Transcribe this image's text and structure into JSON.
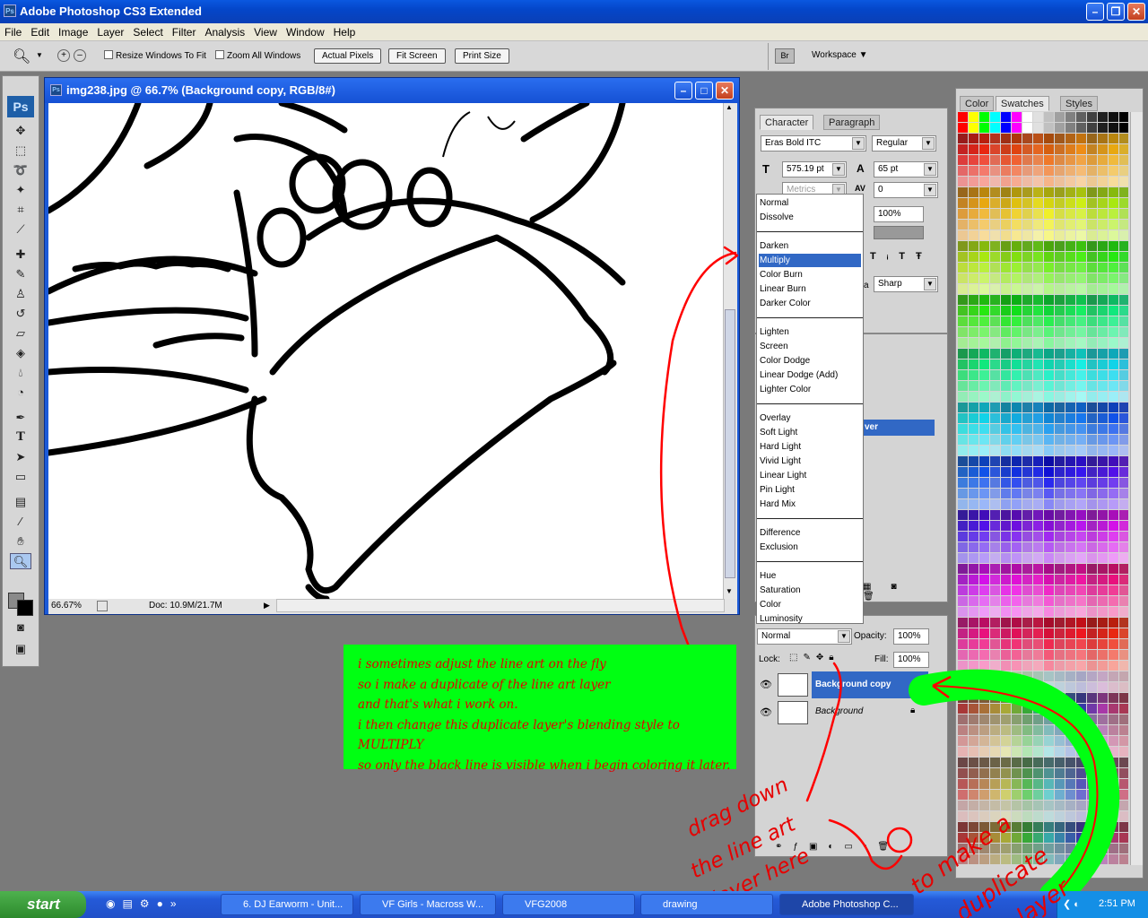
{
  "app": {
    "title": "Adobe Photoshop CS3 Extended",
    "icon_text": "Ps"
  },
  "menu": [
    "File",
    "Edit",
    "Image",
    "Layer",
    "Select",
    "Filter",
    "Analysis",
    "View",
    "Window",
    "Help"
  ],
  "options": {
    "resize_label": "Resize Windows To Fit",
    "zoom_all_label": "Zoom All Windows",
    "actual_pixels": "Actual Pixels",
    "fit_screen": "Fit Screen",
    "print_size": "Print Size",
    "workspace": "Workspace"
  },
  "toolbox": {
    "logo": "Ps"
  },
  "document": {
    "title": "img238.jpg @ 66.7% (Background copy, RGB/8#)",
    "zoom": "66.67%",
    "doc_info": "Doc: 10.9M/21.7M"
  },
  "character": {
    "tabs": [
      "Character",
      "Paragraph"
    ],
    "font_family": "Eras Bold ITC",
    "font_style": "Regular",
    "font_size": "575.19 pt",
    "leading": "65 pt",
    "kerning": "Metrics",
    "tracking": "0",
    "scale": "100%",
    "antialias_prefix": "a",
    "antialias": "Sharp",
    "behind_label": "ver"
  },
  "blend_menu": {
    "selected": "Multiply",
    "groups": [
      [
        "Normal",
        "Dissolve"
      ],
      [
        "Darken",
        "Multiply",
        "Color Burn",
        "Linear Burn",
        "Darker Color"
      ],
      [
        "Lighten",
        "Screen",
        "Color Dodge",
        "Linear Dodge (Add)",
        "Lighter Color"
      ],
      [
        "Overlay",
        "Soft Light",
        "Hard Light",
        "Vivid Light",
        "Linear Light",
        "Pin Light",
        "Hard Mix"
      ],
      [
        "Difference",
        "Exclusion"
      ],
      [
        "Hue",
        "Saturation",
        "Color",
        "Luminosity"
      ]
    ]
  },
  "layers": {
    "blend_mode": "Normal",
    "opacity_label": "Opacity:",
    "opacity": "100%",
    "lock_label": "Lock:",
    "fill_label": "Fill:",
    "fill": "100%",
    "items": [
      {
        "name": "Background copy",
        "selected": true
      },
      {
        "name": "Background",
        "selected": false
      }
    ]
  },
  "swatches": {
    "tabs": [
      "Color",
      "Swatches",
      "Styles"
    ]
  },
  "note": {
    "lines": [
      "i sometimes adjust the line art on the fly",
      "so i make a duplicate of the line art layer",
      "and that's what i work on.",
      "i then change this duplicate layer's  blending style to MULTIPLY",
      "so only the black line is visible when i begin coloring it later."
    ]
  },
  "annotations": {
    "drag_lines": [
      "drag down",
      "the line art",
      "layer here"
    ],
    "dup_lines": [
      "to make a",
      "duplicate",
      "layer"
    ]
  },
  "taskbar": {
    "start": "start",
    "tasks": [
      "6. DJ Earworm - Unit...",
      "VF Girls - Macross W...",
      "VFG2008",
      "drawing",
      "Adobe Photoshop C..."
    ],
    "clock": "2:51 PM"
  },
  "colors": {
    "note_bg": "#00ff12",
    "note_text": "#e10000",
    "selection": "#3168c5"
  }
}
